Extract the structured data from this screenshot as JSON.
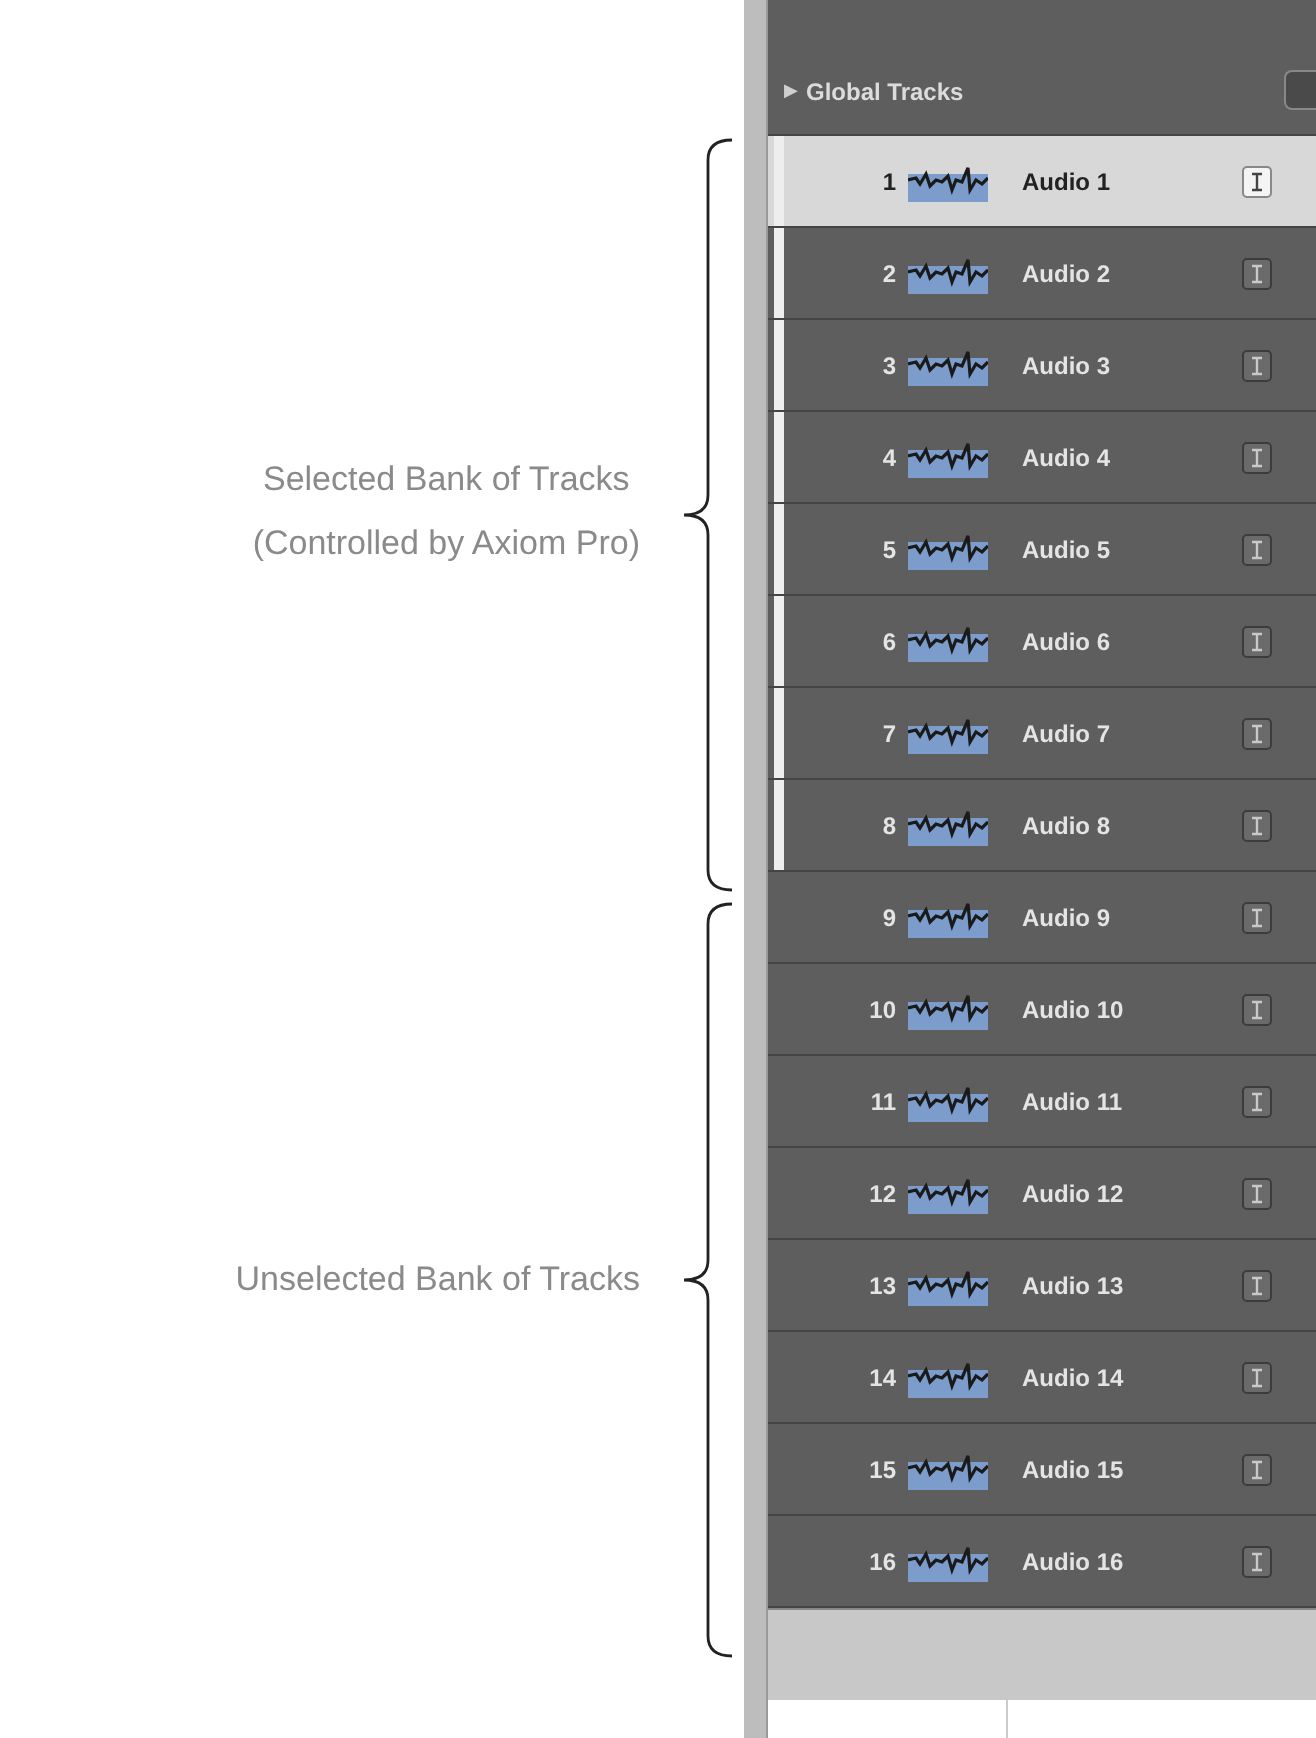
{
  "annotations": [
    {
      "lines": [
        "Selected Bank of Tracks",
        "(Controlled by Axiom Pro)"
      ]
    },
    {
      "lines": [
        "Unselected Bank of Tracks"
      ]
    }
  ],
  "header": {
    "toggle": "▶",
    "title": "Global Tracks"
  },
  "tracks": [
    {
      "number": "1",
      "name": "Audio 1",
      "selected": true,
      "in_bank": true
    },
    {
      "number": "2",
      "name": "Audio 2",
      "selected": false,
      "in_bank": true
    },
    {
      "number": "3",
      "name": "Audio 3",
      "selected": false,
      "in_bank": true
    },
    {
      "number": "4",
      "name": "Audio 4",
      "selected": false,
      "in_bank": true
    },
    {
      "number": "5",
      "name": "Audio 5",
      "selected": false,
      "in_bank": true
    },
    {
      "number": "6",
      "name": "Audio 6",
      "selected": false,
      "in_bank": true
    },
    {
      "number": "7",
      "name": "Audio 7",
      "selected": false,
      "in_bank": true
    },
    {
      "number": "8",
      "name": "Audio 8",
      "selected": false,
      "in_bank": true
    },
    {
      "number": "9",
      "name": "Audio 9",
      "selected": false,
      "in_bank": false
    },
    {
      "number": "10",
      "name": "Audio 10",
      "selected": false,
      "in_bank": false
    },
    {
      "number": "11",
      "name": "Audio 11",
      "selected": false,
      "in_bank": false
    },
    {
      "number": "12",
      "name": "Audio 12",
      "selected": false,
      "in_bank": false
    },
    {
      "number": "13",
      "name": "Audio 13",
      "selected": false,
      "in_bank": false
    },
    {
      "number": "14",
      "name": "Audio 14",
      "selected": false,
      "in_bank": false
    },
    {
      "number": "15",
      "name": "Audio 15",
      "selected": false,
      "in_bank": false
    },
    {
      "number": "16",
      "name": "Audio 16",
      "selected": false,
      "in_bank": false
    }
  ]
}
